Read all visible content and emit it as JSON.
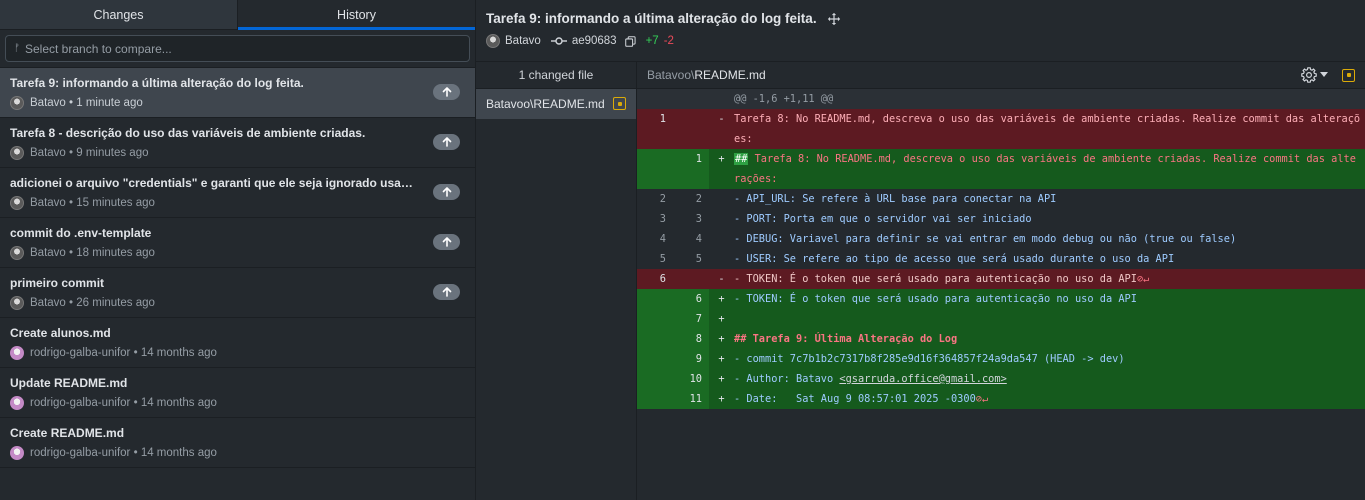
{
  "tabs": {
    "changes": "Changes",
    "history": "History"
  },
  "branch_filter": {
    "placeholder": "Select branch to compare..."
  },
  "commits": [
    {
      "title": "Tarefa 9: informando a última alteração do log feita.",
      "author": "Batavo",
      "time": "1 minute ago",
      "unpushed": true
    },
    {
      "title": "Tarefa 8 - descrição do uso das variáveis de ambiente criadas.",
      "author": "Batavo",
      "time": "9 minutes ago",
      "unpushed": true
    },
    {
      "title": "adicionei o arquivo \"credentials\" e garanti que ele seja ignorado usando ...",
      "author": "Batavo",
      "time": "15 minutes ago",
      "unpushed": true
    },
    {
      "title": "commit do .env-template",
      "author": "Batavo",
      "time": "18 minutes ago",
      "unpushed": true
    },
    {
      "title": "primeiro commit",
      "author": "Batavo",
      "time": "26 minutes ago",
      "unpushed": true
    },
    {
      "title": "Create alunos.md",
      "author": "rodrigo-galba-unifor",
      "time": "14 months ago",
      "unpushed": false
    },
    {
      "title": "Update README.md",
      "author": "rodrigo-galba-unifor",
      "time": "14 months ago",
      "unpushed": false
    },
    {
      "title": "Create README.md",
      "author": "rodrigo-galba-unifor",
      "time": "14 months ago",
      "unpushed": false
    }
  ],
  "meta_separator": "•",
  "header": {
    "title": "Tarefa 9: informando a última alteração do log feita.",
    "author": "Batavo",
    "sha": "ae90683",
    "additions": "+7",
    "deletions": "-2"
  },
  "files": {
    "count_label": "1 changed file",
    "items": [
      {
        "path": "Batavoo\\README.md",
        "status": "modified"
      }
    ]
  },
  "diff": {
    "dir": "Batavoo\\",
    "file": "README.md",
    "hunk": "@@ -1,6 +1,11 @@",
    "lines": [
      {
        "type": "del",
        "old": "1",
        "new": "",
        "marker": "-",
        "text": "Tarefa 8: No README.md, descreva o uso das variáveis de ambiente criadas. Realize commit das alterações:"
      },
      {
        "type": "add",
        "old": "",
        "new": "1",
        "marker": "+",
        "hash": "##",
        "text": " Tarefa 8: No README.md, descreva o uso das variáveis de ambiente criadas. Realize commit das alterações:"
      },
      {
        "type": "ctx",
        "old": "2",
        "new": "2",
        "marker": "",
        "text": "- API_URL: Se refere à URL base para conectar na API"
      },
      {
        "type": "ctx",
        "old": "3",
        "new": "3",
        "marker": "",
        "text": "- PORT: Porta em que o servidor vai ser iniciado"
      },
      {
        "type": "ctx",
        "old": "4",
        "new": "4",
        "marker": "",
        "text": "- DEBUG: Variavel para definir se vai entrar em modo debug ou não (true ou false)"
      },
      {
        "type": "ctx",
        "old": "5",
        "new": "5",
        "marker": "",
        "text": "- USER: Se refere ao tipo de acesso que será usado durante o uso da API"
      },
      {
        "type": "del",
        "old": "6",
        "new": "",
        "marker": "-",
        "text": "- TOKEN: É o token que será usado para autenticação no uso da API",
        "eol": "⊘↵"
      },
      {
        "type": "add",
        "old": "",
        "new": "6",
        "marker": "+",
        "text": "- TOKEN: É o token que será usado para autenticação no uso da API"
      },
      {
        "type": "add",
        "old": "",
        "new": "7",
        "marker": "+",
        "text": ""
      },
      {
        "type": "add",
        "old": "",
        "new": "8",
        "marker": "+",
        "text": "## Tarefa 9: Última Alteração do Log",
        "heading": true
      },
      {
        "type": "add",
        "old": "",
        "new": "9",
        "marker": "+",
        "text": "- commit 7c7b1b2c7317b8f285e9d16f364857f24a9da547 (HEAD -> dev)"
      },
      {
        "type": "add",
        "old": "",
        "new": "10",
        "marker": "+",
        "text": "- Author: Batavo ",
        "email": "<gsarruda.office@gmail.com>"
      },
      {
        "type": "add",
        "old": "",
        "new": "11",
        "marker": "+",
        "text": "- Date:   Sat Aug 9 08:57:01 2025 -0300",
        "eol": "⊘↵"
      }
    ]
  }
}
